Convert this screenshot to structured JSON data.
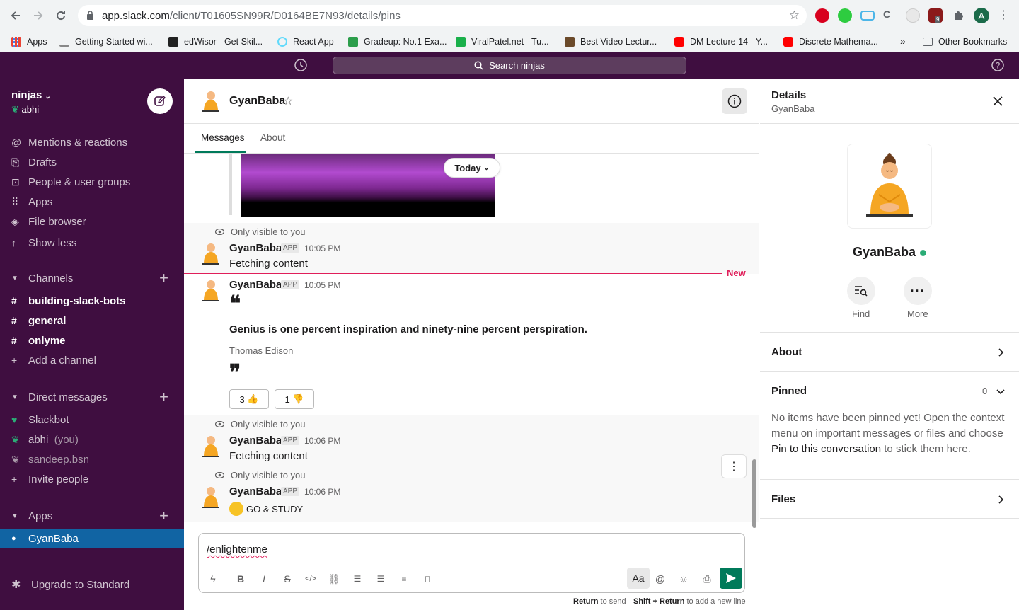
{
  "browser": {
    "url_host": "app.slack.com",
    "url_path": "/client/T01605SN99R/D0164BE7N93/details/pins",
    "bookmarks": [
      {
        "label": "Apps",
        "color": "#4285f4"
      },
      {
        "label": "Getting Started wi...",
        "color": "#888888"
      },
      {
        "label": "edWisor - Get Skil...",
        "color": "#222222"
      },
      {
        "label": "React App",
        "color": "#61dafb"
      },
      {
        "label": "Gradeup: No.1 Exa...",
        "color": "#2c9e4b"
      },
      {
        "label": "ViralPatel.net - Tu...",
        "color": "#1ab04b"
      },
      {
        "label": "Best Video Lectur...",
        "color": "#6b4a2a"
      },
      {
        "label": "DM Lecture 14 - Y...",
        "color": "#ff0000"
      },
      {
        "label": "Discrete Mathema...",
        "color": "#ff0000"
      }
    ],
    "bookmarks_overflow": "»",
    "other_bookmarks": "Other Bookmarks",
    "profile_letter": "A",
    "ext_badge": "9"
  },
  "topbar": {
    "search_placeholder": "Search ninjas"
  },
  "sidebar": {
    "workspace": "ninjas",
    "user": "abhi",
    "nav": [
      {
        "label": "Mentions & reactions",
        "icon": "at-icon"
      },
      {
        "label": "Drafts",
        "icon": "drafts-icon"
      },
      {
        "label": "People & user groups",
        "icon": "people-icon"
      },
      {
        "label": "Apps",
        "icon": "apps-grid-icon"
      },
      {
        "label": "File browser",
        "icon": "layers-icon"
      },
      {
        "label": "Show less",
        "icon": "arrow-up-icon"
      }
    ],
    "channels_title": "Channels",
    "channels": [
      "building-slack-bots",
      "general",
      "onlyme"
    ],
    "add_channel": "Add a channel",
    "dms_title": "Direct messages",
    "dms": [
      {
        "name": "Slackbot",
        "suffix": ""
      },
      {
        "name": "abhi",
        "suffix": "(you)"
      },
      {
        "name": "sandeep.bsn",
        "suffix": ""
      }
    ],
    "invite": "Invite people",
    "apps_title": "Apps",
    "apps": [
      "GyanBaba"
    ],
    "upgrade": "Upgrade to Standard"
  },
  "channel": {
    "title": "GyanBaba",
    "tabs": [
      "Messages",
      "About"
    ],
    "today_label": "Today",
    "new_label": "New",
    "ephemeral_label": "Only visible to you",
    "app_badge": "APP",
    "messages": [
      {
        "sender": "GyanBaba",
        "time": "10:05 PM",
        "text": "Fetching content"
      },
      {
        "sender": "GyanBaba",
        "time": "10:05 PM",
        "quote_open": "❝",
        "quote": "Genius is one percent inspiration and ninety-nine percent perspiration.",
        "author": "Thomas Edison",
        "quote_close": "❞",
        "reactions": [
          {
            "count": "3",
            "emoji": "👍"
          },
          {
            "count": "1",
            "emoji": "👎"
          }
        ]
      },
      {
        "sender": "GyanBaba",
        "time": "10:06 PM",
        "text": "Fetching content"
      },
      {
        "sender": "GyanBaba",
        "time": "10:06 PM",
        "text": "GO & STUDY"
      }
    ],
    "composer_value": "/enlightenme",
    "hint_send_key": "Return",
    "hint_send": "to send",
    "hint_newline_key": "Shift + Return",
    "hint_newline": "to add a new line",
    "format_label": "Aa"
  },
  "details": {
    "title": "Details",
    "subtitle": "GyanBaba",
    "name": "GyanBaba",
    "find": "Find",
    "more": "More",
    "about": "About",
    "pinned": "Pinned",
    "pinned_count": "0",
    "pinned_text_1": "No items have been pinned yet! Open the context menu on important messages or files and choose",
    "pinned_link": "Pin to this conversation",
    "pinned_text_2": "to stick them here.",
    "files": "Files"
  },
  "colors": {
    "sidebar_bg": "#3f0e40",
    "active_item": "#1164a3",
    "send_green": "#007a5a",
    "new_red": "#e01e5a",
    "online_green": "#2bac76"
  }
}
